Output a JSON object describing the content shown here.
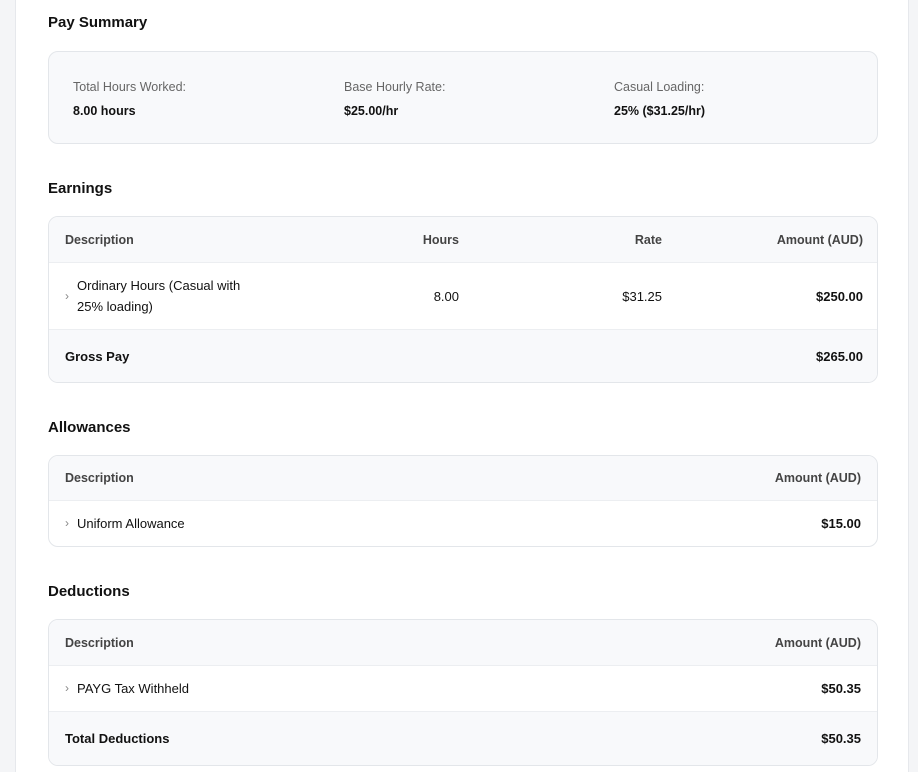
{
  "pay_summary": {
    "title": "Pay Summary",
    "items": [
      {
        "label": "Total Hours Worked:",
        "value": "8.00 hours"
      },
      {
        "label": "Base Hourly Rate:",
        "value": "$25.00/hr"
      },
      {
        "label": "Casual Loading:",
        "value": "25% ($31.25/hr)"
      }
    ]
  },
  "earnings": {
    "title": "Earnings",
    "headers": [
      "Description",
      "Hours",
      "Rate",
      "Amount (AUD)"
    ],
    "rows": [
      {
        "description": "Ordinary Hours (Casual with 25% loading)",
        "hours": "8.00",
        "rate": "$31.25",
        "amount": "$250.00"
      }
    ],
    "total_label": "Gross Pay",
    "total_amount": "$265.00"
  },
  "allowances": {
    "title": "Allowances",
    "headers": [
      "Description",
      "Amount (AUD)"
    ],
    "rows": [
      {
        "description": "Uniform Allowance",
        "amount": "$15.00"
      }
    ]
  },
  "deductions": {
    "title": "Deductions",
    "headers": [
      "Description",
      "Amount (AUD)"
    ],
    "rows": [
      {
        "description": "PAYG Tax Withheld",
        "amount": "$50.35"
      }
    ],
    "total_label": "Total Deductions",
    "total_amount": "$50.35"
  },
  "icons": {
    "expand": "›"
  }
}
